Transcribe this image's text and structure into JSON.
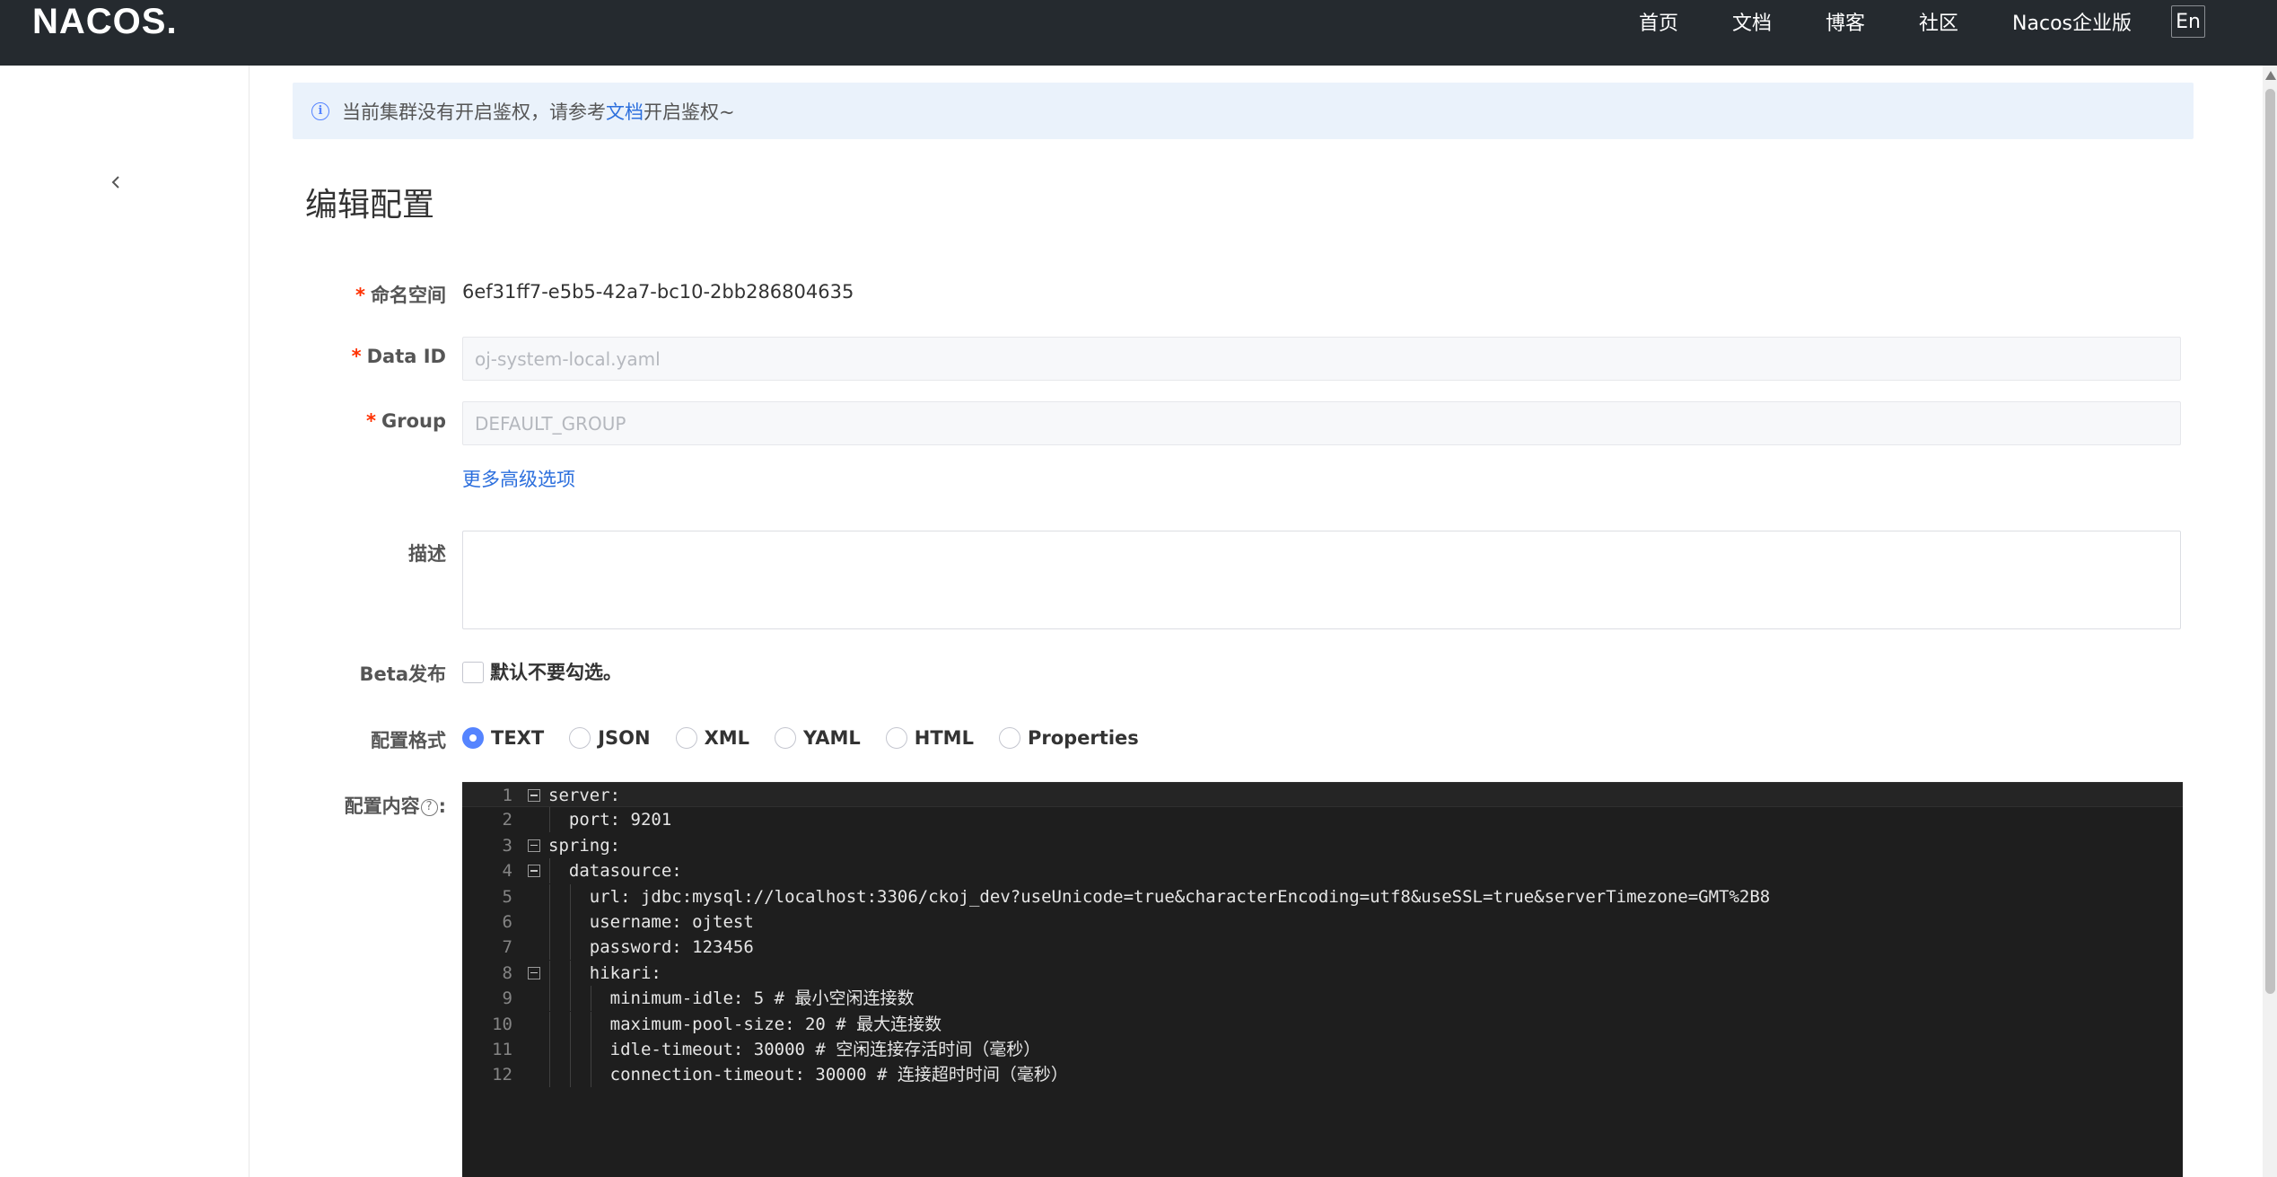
{
  "header": {
    "logo": "NACOS.",
    "nav": [
      "首页",
      "文档",
      "博客",
      "社区",
      "Nacos企业版"
    ],
    "lang": "En"
  },
  "notice": {
    "text_before": "当前集群没有开启鉴权，请参考",
    "link": "文档",
    "text_after": "开启鉴权~"
  },
  "page": {
    "title": "编辑配置"
  },
  "form": {
    "namespace": {
      "label": "命名空间",
      "value": "6ef31ff7-e5b5-42a7-bc10-2bb286804635"
    },
    "data_id": {
      "label": "Data ID",
      "value": "oj-system-local.yaml"
    },
    "group": {
      "label": "Group",
      "value": "DEFAULT_GROUP"
    },
    "advanced_link": "更多高级选项",
    "description": {
      "label": "描述",
      "value": ""
    },
    "beta": {
      "label": "Beta发布",
      "checkbox_label": "默认不要勾选。"
    },
    "format": {
      "label": "配置格式",
      "options": [
        "TEXT",
        "JSON",
        "XML",
        "YAML",
        "HTML",
        "Properties"
      ],
      "selected": "TEXT"
    },
    "content": {
      "label_text": "配置内容",
      "label_suffix": ":"
    }
  },
  "editor": {
    "lines": [
      {
        "n": "1",
        "text": "server:"
      },
      {
        "n": "2",
        "text": "  port: 9201"
      },
      {
        "n": "3",
        "text": "spring:"
      },
      {
        "n": "4",
        "text": "  datasource:"
      },
      {
        "n": "5",
        "text": "    url: jdbc:mysql://localhost:3306/ckoj_dev?useUnicode=true&characterEncoding=utf8&useSSL=true&serverTimezone=GMT%2B8"
      },
      {
        "n": "6",
        "text": "    username: ojtest"
      },
      {
        "n": "7",
        "text": "    password: 123456"
      },
      {
        "n": "8",
        "text": "    hikari:"
      },
      {
        "n": "9",
        "text": "      minimum-idle: 5 # 最小空闲连接数"
      },
      {
        "n": "10",
        "text": "      maximum-pool-size: 20 # 最大连接数"
      },
      {
        "n": "11",
        "text": "      idle-timeout: 30000 # 空闲连接存活时间（毫秒）"
      },
      {
        "n": "12",
        "text": "      connection-timeout: 30000 # 连接超时时间（毫秒）"
      }
    ]
  },
  "colors": {
    "header_bg": "#252a2f",
    "accent": "#5584ff",
    "link": "#2c6fdd",
    "required": "#ff3000",
    "editor_bg": "#1e1e1e"
  }
}
